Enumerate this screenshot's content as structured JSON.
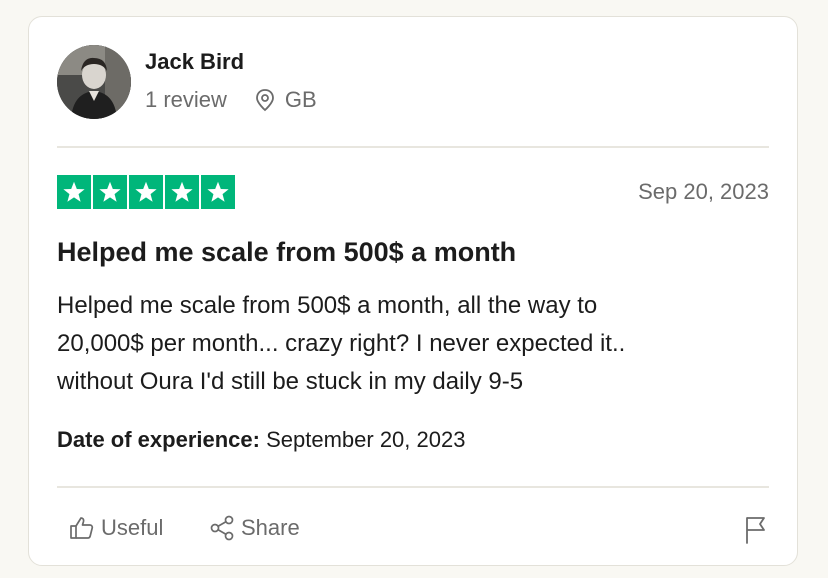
{
  "reviewer": {
    "name": "Jack Bird",
    "review_count": "1 review",
    "country": "GB"
  },
  "rating": {
    "stars": 5,
    "max": 5,
    "color": "#00b67a"
  },
  "review": {
    "date": "Sep 20, 2023",
    "title": "Helped me scale from 500$ a month",
    "body_lines": [
      "Helped me scale from 500$ a month, all the way to",
      "20,000$ per month... crazy right? I never expected it..",
      "without Oura I'd still be stuck in my daily 9-5"
    ],
    "experience_label": "Date of experience:",
    "experience_date": "September 20, 2023"
  },
  "actions": {
    "useful_label": "Useful",
    "share_label": "Share"
  },
  "icons": {
    "location": "location-pin-icon",
    "useful": "thumbs-up-icon",
    "share": "share-icon",
    "report": "flag-icon"
  }
}
